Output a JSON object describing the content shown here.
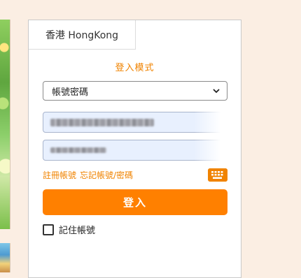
{
  "region_tab": {
    "label": "香港 HongKong"
  },
  "login": {
    "mode_title": "登入模式",
    "account_type_select": {
      "selected": "帳號密碼"
    },
    "username_field": {
      "value": ""
    },
    "password_field": {
      "value": ""
    },
    "register_link": "註冊帳號",
    "forgot_link": "忘記帳號/密碼",
    "submit_label": "登入",
    "remember_label": "記住帳號"
  },
  "colors": {
    "accent": "#ff8000",
    "link": "#f08300",
    "input_bg": "#e8f0fe",
    "page_bg": "#fbeee3"
  }
}
